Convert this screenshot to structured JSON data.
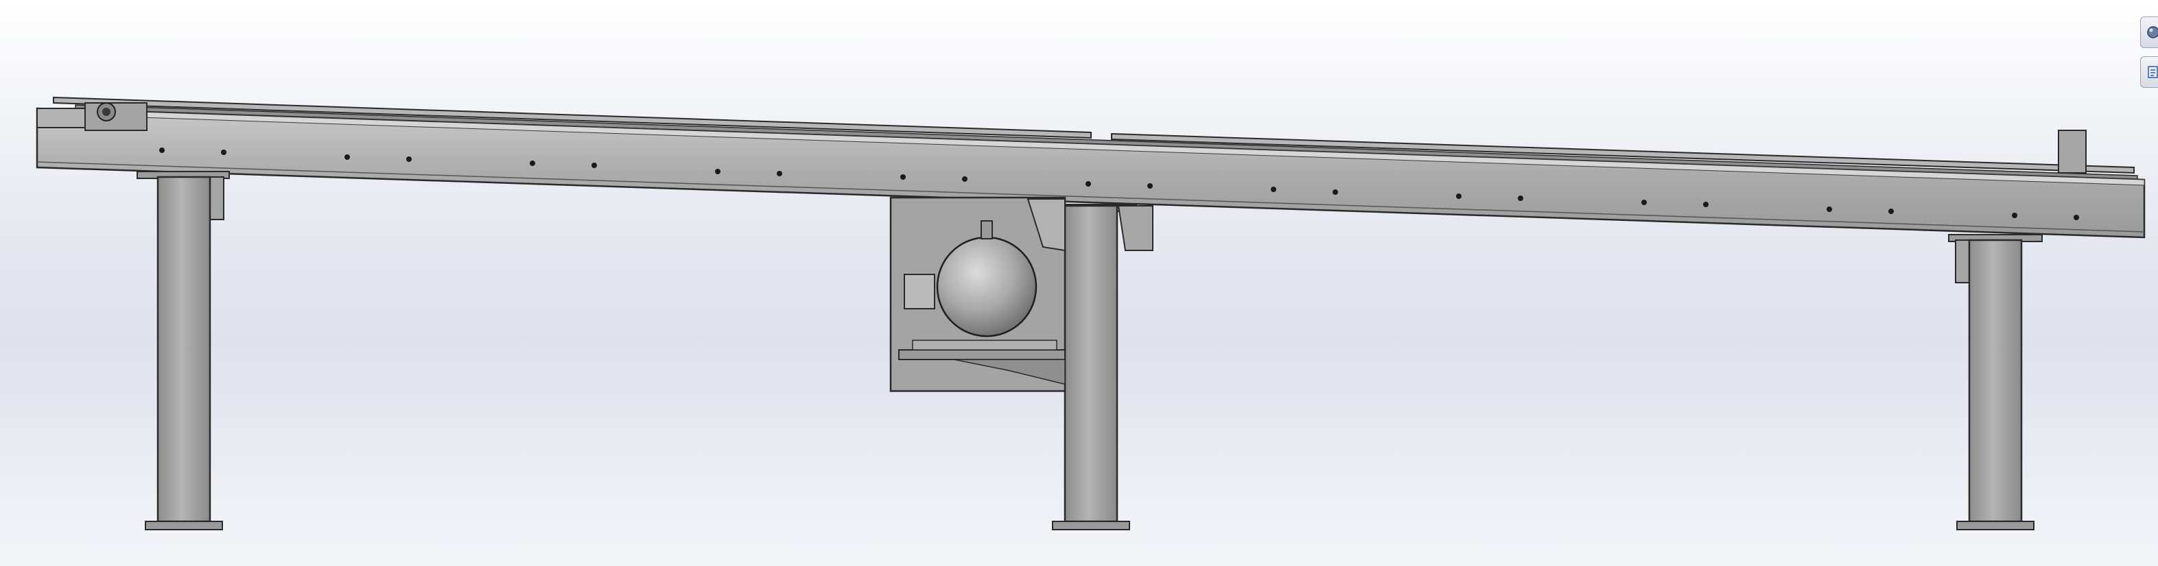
{
  "app": {
    "name": "CAD 3D viewport",
    "view": "front"
  },
  "colors": {
    "background_top": "#ffffff",
    "background_mid": "#e3e6ee",
    "steel_face": "#a9a9a9",
    "steel_dark": "#7e7e7e",
    "steel_light": "#c8c8c8",
    "edge": "#2a2a2a",
    "hole": "#1a1a1a"
  },
  "icons": {
    "toolbar_top": "appearance-icon",
    "toolbar_bottom": "custom-properties-icon"
  },
  "model": {
    "components": [
      "conveyor-frame",
      "left-leg",
      "center-leg",
      "right-leg",
      "drive-motor",
      "motor-mount-plate",
      "bearing-housing",
      "end-stop-block"
    ]
  }
}
